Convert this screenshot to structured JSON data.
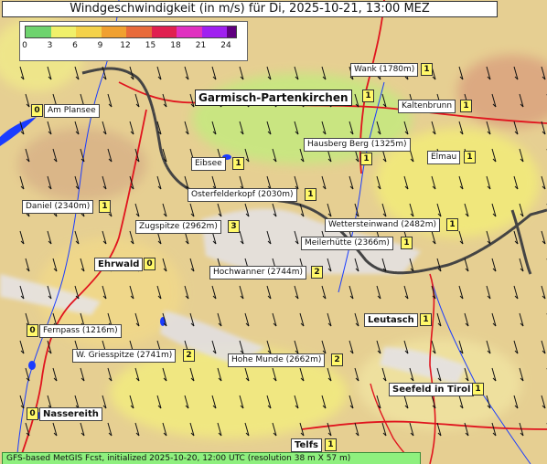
{
  "title": "Windgeschwindigkeit (in m/s) für Di, 2025-10-21, 13:00 MEZ",
  "legend": {
    "unit": "m/s",
    "ticks": [
      "0",
      "3",
      "6",
      "9",
      "12",
      "15",
      "18",
      "21",
      "24"
    ],
    "colors": [
      "#6ed36e",
      "#f0f06a",
      "#f4d24a",
      "#f0a030",
      "#e86a3a",
      "#e02050",
      "#e030c0",
      "#a020f0",
      "#600080"
    ]
  },
  "locations": [
    {
      "id": "wank",
      "name": "Wank (1780m)",
      "value": "1"
    },
    {
      "id": "garmisch",
      "name": "Garmisch-Partenkirchen",
      "value": "1"
    },
    {
      "id": "plansee",
      "name": "Am Plansee",
      "value": "0"
    },
    {
      "id": "kaltenbrunn",
      "name": "Kaltenbrunn",
      "value": "1"
    },
    {
      "id": "hausberg",
      "name": "Hausberg Berg (1325m)",
      "value": "1"
    },
    {
      "id": "elmau",
      "name": "Elmau",
      "value": "1"
    },
    {
      "id": "eibsee",
      "name": "Eibsee",
      "value": "1"
    },
    {
      "id": "osterfelder",
      "name": "Osterfelderkopf (2030m)",
      "value": "1"
    },
    {
      "id": "daniel",
      "name": "Daniel (2340m)",
      "value": "1"
    },
    {
      "id": "zugspitze",
      "name": "Zugspitze (2962m)",
      "value": "3"
    },
    {
      "id": "wetterstein",
      "name": "Wettersteinwand (2482m)",
      "value": "1"
    },
    {
      "id": "meiler",
      "name": "Meilerhütte (2366m)",
      "value": "1"
    },
    {
      "id": "ehrwald",
      "name": "Ehrwald",
      "value": "0"
    },
    {
      "id": "hochwanner",
      "name": "Hochwanner (2744m)",
      "value": "2"
    },
    {
      "id": "leutasch",
      "name": "Leutasch",
      "value": "1"
    },
    {
      "id": "fernpass",
      "name": "Fernpass (1216m)",
      "value": "0"
    },
    {
      "id": "griesspitze",
      "name": "W. Griesspitze (2741m)",
      "value": "2"
    },
    {
      "id": "hohemunde",
      "name": "Hohe Munde (2662m)",
      "value": "2"
    },
    {
      "id": "seefeld",
      "name": "Seefeld in Tirol",
      "value": "1"
    },
    {
      "id": "nassereith",
      "name": "Nassereith",
      "value": "0"
    },
    {
      "id": "telfs",
      "name": "Telfs",
      "value": "1"
    }
  ],
  "footer": "GFS-based MetGIS Fcst, initialized 2025-10-20, 12:00 UTC  (resolution 38 m X 57 m)"
}
